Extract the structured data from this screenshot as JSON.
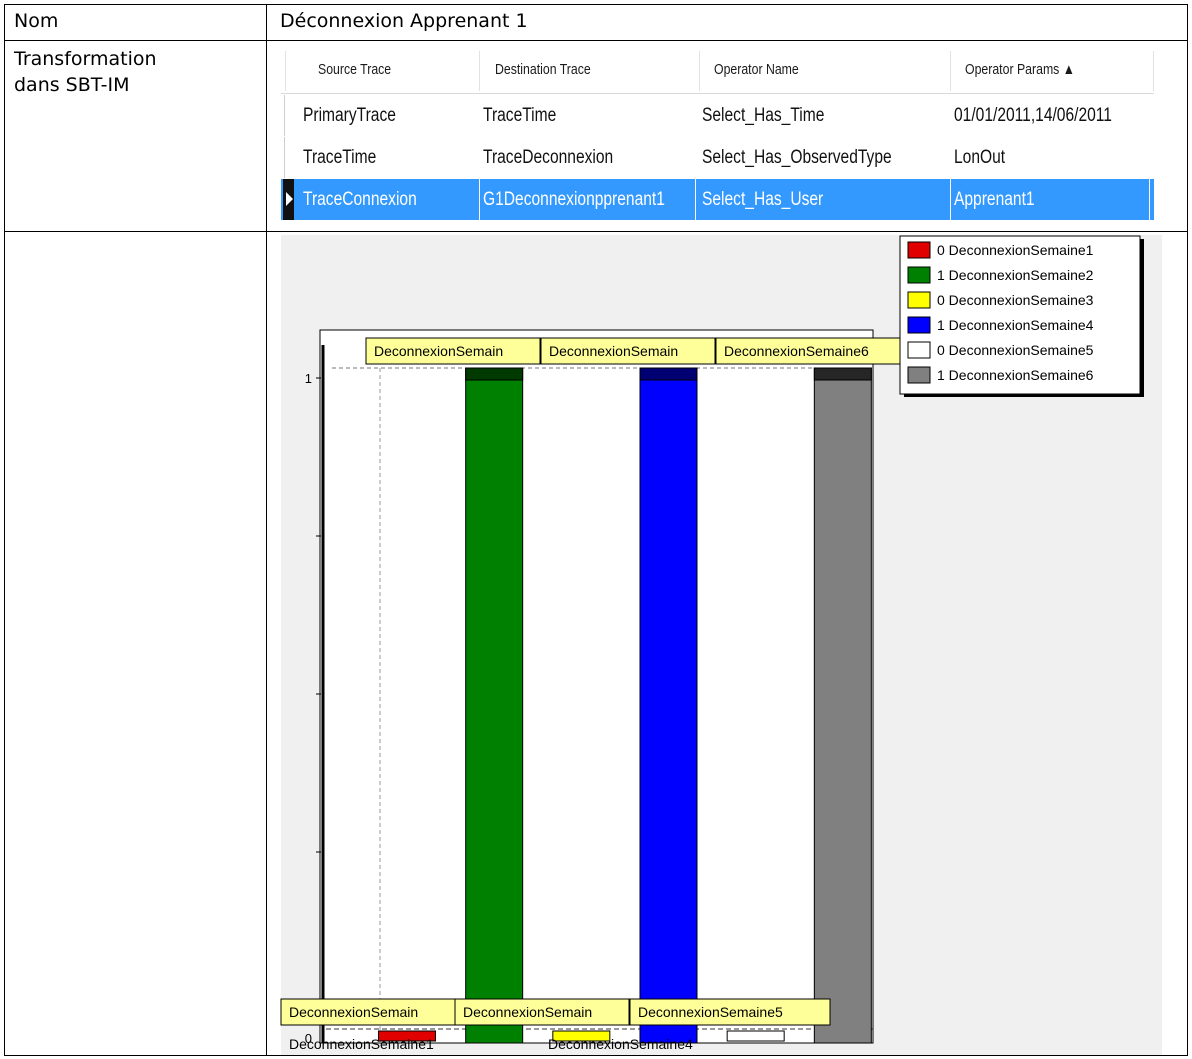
{
  "table": {
    "row1_label": "Nom",
    "row1_value": "Déconnexion Apprenant 1",
    "row2_label_line1": "Transformation",
    "row2_label_line2": "dans SBT-IM"
  },
  "grid": {
    "columns": [
      "Source Trace",
      "Destination Trace",
      "Operator Name",
      "Operator Params ▲"
    ],
    "rows": [
      {
        "source": "PrimaryTrace",
        "destination": "TraceTime",
        "operator": "Select_Has_Time",
        "params": "01/01/2011,14/06/2011",
        "selected": false
      },
      {
        "source": "TraceTime",
        "destination": "TraceDeconnexion",
        "operator": "Select_Has_ObservedType",
        "params": "LonOut",
        "selected": false
      },
      {
        "source": "TraceConnexion",
        "destination": "G1Deconnexionpprenant1",
        "operator": "Select_Has_User",
        "params": "Apprenant1",
        "selected": true
      }
    ],
    "selection_color": "#3399ff"
  },
  "chart_data": {
    "type": "bar",
    "categories": [
      "DeconnexionSemaine1",
      "DeconnexionSemaine2",
      "DeconnexionSemaine3",
      "DeconnexionSemaine4",
      "DeconnexionSemaine5",
      "DeconnexionSemaine6"
    ],
    "values": [
      0,
      1,
      0,
      1,
      0,
      1
    ],
    "colors": [
      "#e00000",
      "#008000",
      "#ffff00",
      "#0000ff",
      "#ffffff",
      "#808080"
    ],
    "ylim": [
      0,
      1
    ],
    "y_ticks": [
      "0",
      "1"
    ],
    "x_tick_labels": [
      "DeconnexionSemaine1",
      "DeconnexionSemaine4"
    ],
    "legend": [
      {
        "text": "0 DeconnexionSemaine1",
        "color": "#e00000"
      },
      {
        "text": "1 DeconnexionSemaine2",
        "color": "#008000"
      },
      {
        "text": "0 DeconnexionSemaine3",
        "color": "#ffff00"
      },
      {
        "text": "1 DeconnexionSemaine4",
        "color": "#0000ff"
      },
      {
        "text": "0 DeconnexionSemaine5",
        "color": "#ffffff"
      },
      {
        "text": "1 DeconnexionSemaine6",
        "color": "#808080"
      }
    ],
    "legend_position": "top-right",
    "top_marks": [
      "DeconnexionSemain",
      "DeconnexionSemain",
      "DeconnexionSemaine6"
    ],
    "bottom_marks": [
      "DeconnexionSemain",
      "DeconnexionSemain",
      "DeconnexionSemaine5"
    ]
  }
}
